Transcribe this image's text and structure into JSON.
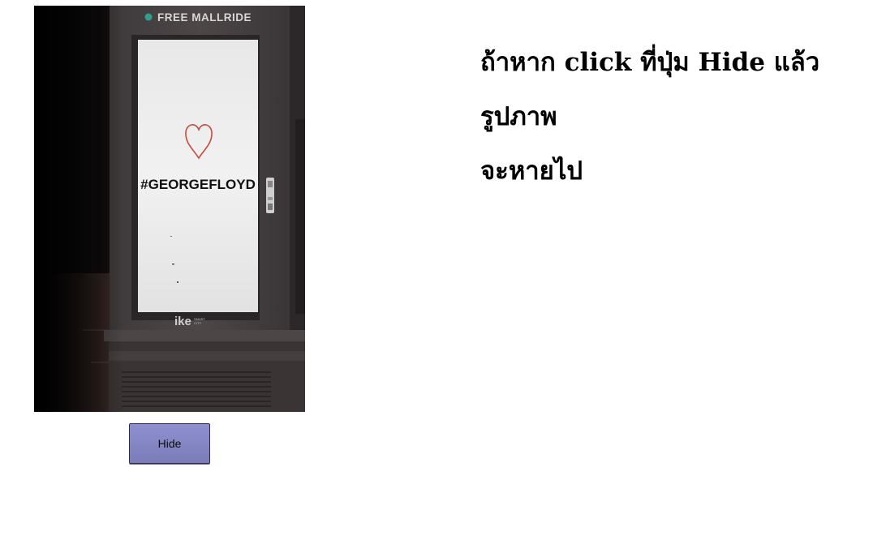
{
  "photo": {
    "kiosk_header": "FREE MALLRIDE",
    "poster_text": "#GEORGEFLOYD",
    "brand": "ike",
    "brand_sub_1": "SMART",
    "brand_sub_2": "CITY"
  },
  "controls": {
    "hide_label": "Hide"
  },
  "message": {
    "line1": "ถ้าหาก click ที่ปุ่ม Hide แล้วรูปภาพ",
    "line2": "จะหายไป"
  },
  "colors": {
    "button_bg": "#8486c4",
    "heart": "#c84a3c"
  }
}
